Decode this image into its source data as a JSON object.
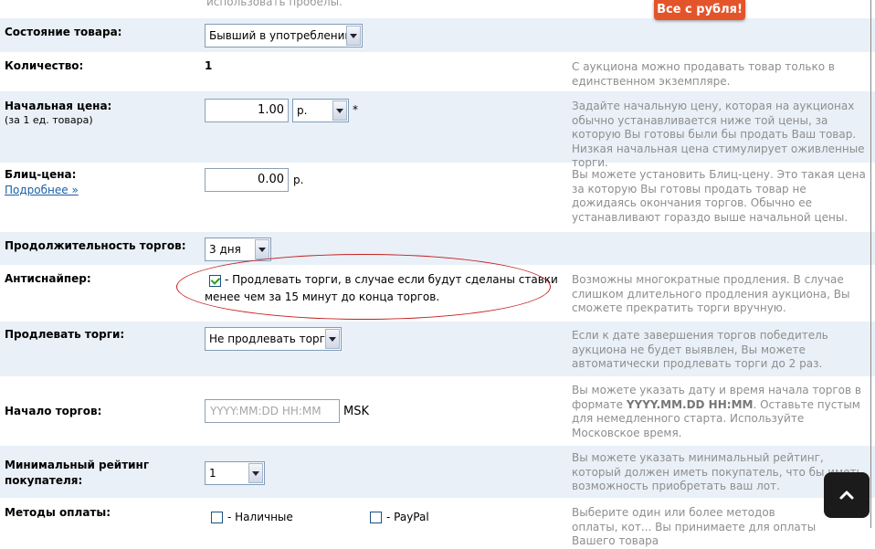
{
  "top_hint": "использовать пробелы.",
  "badge": "Все с рубля!",
  "condition": {
    "label": "Состояние товара:",
    "value": "Бывший в употреблении"
  },
  "quantity": {
    "label": "Количество:",
    "value": "1",
    "hint": "С аукциона можно продавать товар только в единственном экземпляре."
  },
  "start_price": {
    "label": "Начальная цена:",
    "sublabel": "(за 1 ед. товара)",
    "value": "1.00",
    "currency": "р.",
    "required": "*",
    "hint": "Задайте начальную цену, которая на аукционах обычно устанавливается ниже той цены, за которую Вы готовы были бы продать Ваш товар. Низкая начальная цена стимулирует оживленные торги."
  },
  "blitz": {
    "label": "Блиц-цена:",
    "link": "Подробнее »",
    "value": "0.00",
    "currency": "р.",
    "hint": "Вы можете установить Блиц-цену. Это такая цена за которую Вы готовы продать товар не дожидаясь окончания торгов. Обычно ее устанавливают гораздо выше начальной цены."
  },
  "duration": {
    "label": "Продолжительность торгов:",
    "value": "3 дня"
  },
  "antisniper": {
    "label": "Антиснайпер:",
    "text_line1": "- Продлевать торги, в случае если будут сделаны ставки",
    "text_line2": "менее чем за 15 минут до конца торгов.",
    "checked": true,
    "hint": "Возможны многократные продления. В случае слишком длительного продления аукциона, Вы сможете прекратить торги вручную."
  },
  "extend": {
    "label": "Продлевать торги:",
    "value": "Не продлевать торги",
    "hint": "Если к дате завершения торгов победитель аукциона не будет выявлен, Вы можете автоматически продлевать торги до 2 раз."
  },
  "start": {
    "label": "Начало торгов:",
    "placeholder": "YYYY:MM:DD HH:MM",
    "tz": "MSK",
    "hint_pre": "Вы можете указать дату и время начала торгов в формате ",
    "hint_format": "YYYY.MM.DD HH:MM",
    "hint_post": ". Оставьте пустым для немедленного старта. Используйте Московское время."
  },
  "min_rating": {
    "label": "Минимальный рейтинг покупателя:",
    "value": "1",
    "hint": "Вы можете указать минимальный рейтинг, который должен иметь покупатель, что бы иметь возможность приобретать ваш лот."
  },
  "payment": {
    "label": "Методы оплаты:",
    "cash": "- Наличные",
    "paypal": "- PayPal",
    "hint": "Выберите один или более методов оплаты, кот... Вы принимаете для оплаты Вашего товара"
  },
  "colors": {
    "row_alt": "#e9f0f7",
    "badge": "#e4542a",
    "hint": "#8e8e8e",
    "link": "#1a5fa8",
    "ellipse": "#c42020"
  }
}
